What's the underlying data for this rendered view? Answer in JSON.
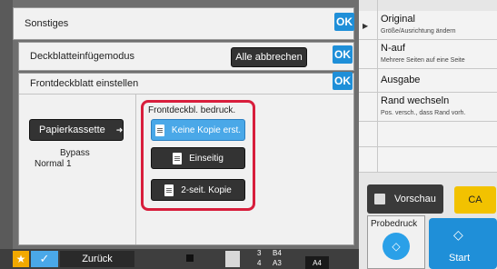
{
  "header": {
    "title": "Sonstiges",
    "ok": "OK"
  },
  "cover_mode": {
    "title": "Deckblatteinfügemodus",
    "cancel_all": "Alle abbrechen",
    "ok": "OK"
  },
  "front_cover": {
    "title": "Frontdeckblatt einstellen",
    "ok": "OK"
  },
  "left": {
    "paper_tray_button": "Papierkassette",
    "bypass_line1": "Bypass",
    "bypass_line2": "Normal 1"
  },
  "print_group": {
    "label": "Frontdeckbl. bedruck.",
    "options": [
      {
        "label": "Keine Kopie erst.",
        "selected": true
      },
      {
        "label": "Einseitig",
        "selected": false
      },
      {
        "label": "2-seit. Kopie",
        "selected": false
      }
    ]
  },
  "right_menu": {
    "items": [
      {
        "title": "Original",
        "subtitle": "Größe/Ausrichtung ändern"
      },
      {
        "title": "N-auf",
        "subtitle": "Mehrere Seiten auf eine Seite"
      },
      {
        "title": "Ausgabe",
        "subtitle": ""
      },
      {
        "title": "Rand wechseln",
        "subtitle": "Pos. versch., dass Rand vorh."
      }
    ]
  },
  "actions": {
    "preview": "Vorschau",
    "ca": "CA",
    "proof_print": "Probedruck",
    "start": "Start"
  },
  "bottom": {
    "back": "Zurück",
    "tray_row1_num": "3",
    "tray_row1_size": "B4",
    "tray_row2_num": "4",
    "tray_row2_size": "A3",
    "current_size": "A4"
  },
  "colors": {
    "accent_blue": "#1f8fd8",
    "highlight_red": "#d81e3c",
    "ca_yellow": "#f2c200",
    "selected_blue": "#4aa8e8"
  }
}
